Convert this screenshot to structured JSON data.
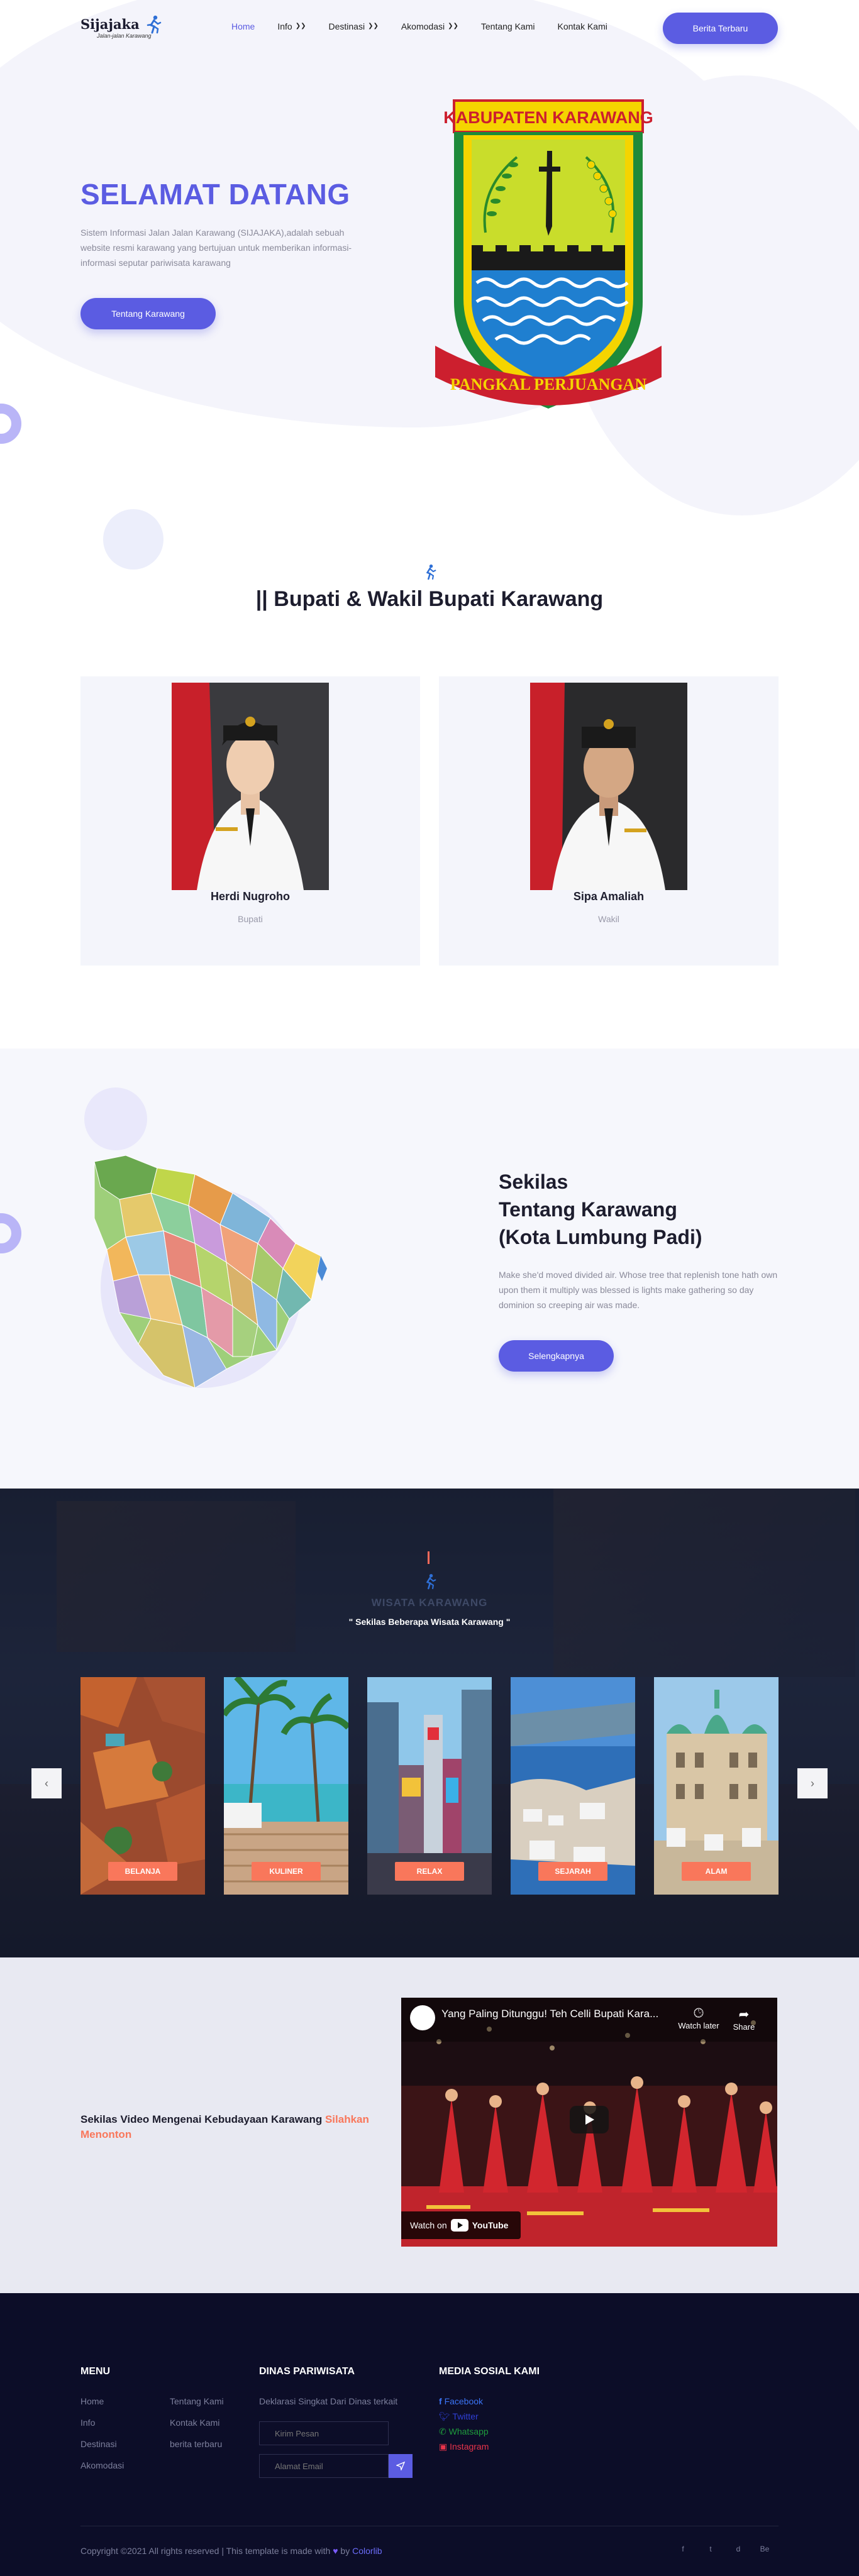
{
  "header": {
    "logo_text": "Sijajaka",
    "logo_sub": "Jalan-jalan Karawang",
    "nav": [
      {
        "label": "Home",
        "active": true,
        "dropdown": false
      },
      {
        "label": "Info",
        "active": false,
        "dropdown": true
      },
      {
        "label": "Destinasi",
        "active": false,
        "dropdown": true
      },
      {
        "label": "Akomodasi",
        "active": false,
        "dropdown": true
      },
      {
        "label": "Tentang Kami",
        "active": false,
        "dropdown": false
      },
      {
        "label": "Kontak Kami",
        "active": false,
        "dropdown": false
      }
    ],
    "cta": "Berita Terbaru"
  },
  "hero": {
    "title": "SELAMAT DATANG",
    "description": "Sistem Informasi Jalan Jalan Karawang (SIJAJAKA),adalah sebuah website resmi karawang yang bertujuan untuk memberikan informasi-informasi seputar pariwisata karawang",
    "button": "Tentang Karawang",
    "emblem_top": "KABUPATEN KARAWANG",
    "emblem_bottom": "PANGKAL PERJUANGAN"
  },
  "bupati": {
    "title": "|| Bupati & Wakil Bupati Karawang",
    "people": [
      {
        "name": "Herdi Nugroho",
        "role": "Bupati"
      },
      {
        "name": "Sipa Amaliah",
        "role": "Wakil"
      }
    ]
  },
  "about": {
    "title_line1": "Sekilas",
    "title_line2": "Tentang Karawang",
    "title_line3": "(Kota Lumbung Padi)",
    "description": "Make she'd moved divided air. Whose tree that replenish tone hath own upon them it multiply was blessed is lights make gathering so day dominion so creeping air was made.",
    "button": "Selengkapnya"
  },
  "wisata": {
    "label": "WISATA KARAWANG",
    "subtitle": "\" Sekilas Beberapa Wisata Karawang \"",
    "prev": "‹",
    "next": "›",
    "slides": [
      {
        "label": "BELANJA"
      },
      {
        "label": "KULINER"
      },
      {
        "label": "RELAX"
      },
      {
        "label": "SEJARAH"
      },
      {
        "label": "ALAM"
      }
    ]
  },
  "video": {
    "text": "Sekilas Video Mengenai Kebudayaan Karawang",
    "highlight": "Silahkan Menonton",
    "video_title": "Yang Paling Ditunggu! Teh Celli Bupati Kara...",
    "watch_later": "Watch later",
    "share": "Share",
    "watch_on": "Watch on",
    "youtube": "YouTube"
  },
  "footer": {
    "menu_title": "MENU",
    "menu_col1": [
      "Home",
      "Info",
      "Destinasi",
      "Akomodasi"
    ],
    "menu_col2": [
      "Tentang Kami",
      "Kontak Kami",
      "berita terbaru"
    ],
    "dinas_title": "DINAS PARIWISATA",
    "dinas_desc": "Deklarasi Singkat Dari Dinas terkait",
    "input1_placeholder": "Kirim Pesan",
    "input2_placeholder": "Alamat Email",
    "social_title": "MEDIA SOSIAL KAMI",
    "social": [
      {
        "label": "Facebook",
        "color": "#3b74f5"
      },
      {
        "label": "Twitter",
        "color": "#2f3fd6"
      },
      {
        "label": "Whatsapp",
        "color": "#1e9c3c"
      },
      {
        "label": "Instagram",
        "color": "#e8334a"
      }
    ],
    "copyright": "Copyright ©2021 All rights reserved | This template is made with",
    "by": "by",
    "brand": "Colorlib",
    "icons": [
      "f",
      "t",
      "d",
      "Be"
    ]
  },
  "colors": {
    "accent": "#5b5ce2",
    "orange": "#f9775b",
    "footer_bg": "#0c0d28"
  }
}
